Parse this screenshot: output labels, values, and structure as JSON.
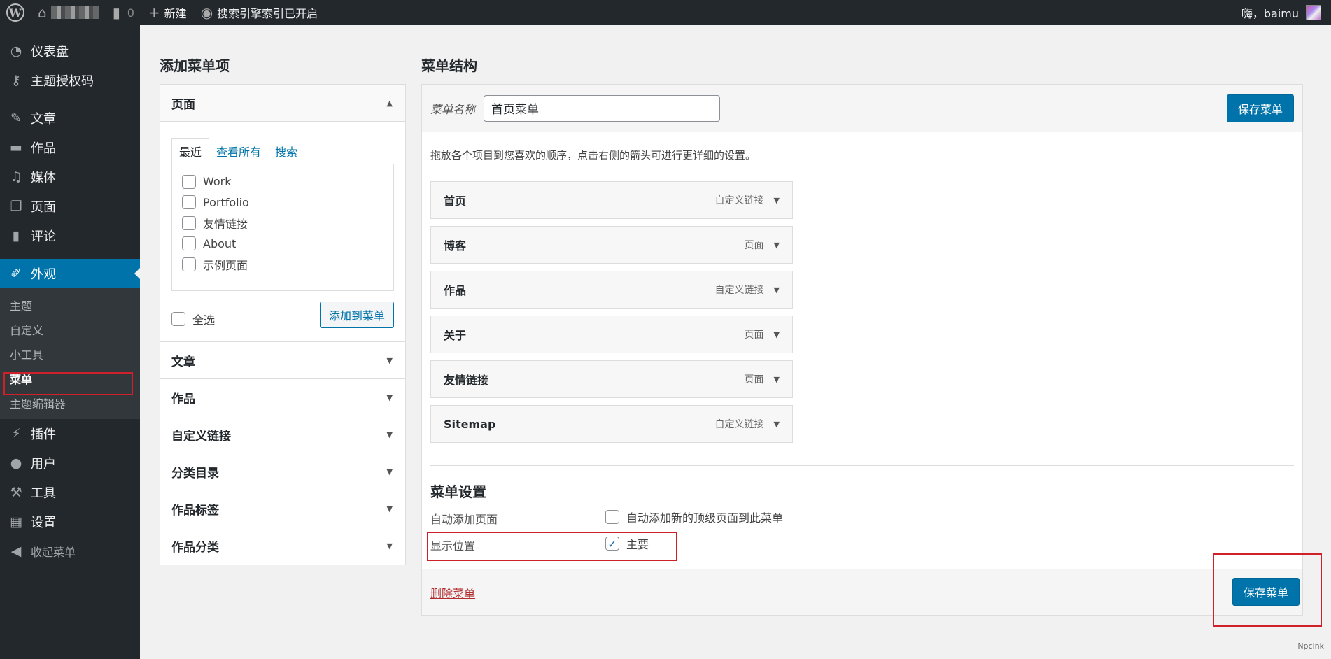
{
  "adminbar": {
    "site_comments": "0",
    "new_label": "新建",
    "search_notice": "搜索引擎索引已开启",
    "greeting": "嗨，baimu"
  },
  "sidebar": {
    "items": [
      {
        "label": "仪表盘",
        "icon": "dashboard-icon"
      },
      {
        "label": "主题授权码",
        "icon": "key-icon"
      },
      {
        "label": "文章",
        "icon": "pin-icon"
      },
      {
        "label": "作品",
        "icon": "folder-icon"
      },
      {
        "label": "媒体",
        "icon": "media-icon"
      },
      {
        "label": "页面",
        "icon": "page-icon"
      },
      {
        "label": "评论",
        "icon": "comment-icon"
      },
      {
        "label": "外观",
        "icon": "brush-icon"
      }
    ],
    "submenu": [
      "主题",
      "自定义",
      "小工具",
      "菜单",
      "主题编辑器"
    ],
    "items_bottom": [
      {
        "label": "插件",
        "icon": "plugin-icon"
      },
      {
        "label": "用户",
        "icon": "user-icon"
      },
      {
        "label": "工具",
        "icon": "wrench-icon"
      },
      {
        "label": "设置",
        "icon": "settings-icon"
      }
    ],
    "collapse_label": "收起菜单"
  },
  "add_items": {
    "title": "添加菜单项",
    "pages_section": "页面",
    "tabs": [
      "最近",
      "查看所有",
      "搜索"
    ],
    "pages": [
      "Work",
      "Portfolio",
      "友情链接",
      "About",
      "示例页面"
    ],
    "select_all": "全选",
    "add_button": "添加到菜单",
    "sections": [
      "文章",
      "作品",
      "自定义链接",
      "分类目录",
      "作品标签",
      "作品分类"
    ]
  },
  "structure": {
    "title": "菜单结构",
    "name_label": "菜单名称",
    "name_value": "首页菜单",
    "save_label": "保存菜单",
    "instructions": "拖放各个项目到您喜欢的顺序，点击右侧的箭头可进行更详细的设置。",
    "menu_items": [
      {
        "title": "首页",
        "type": "自定义链接"
      },
      {
        "title": "博客",
        "type": "页面"
      },
      {
        "title": "作品",
        "type": "自定义链接"
      },
      {
        "title": "关于",
        "type": "页面"
      },
      {
        "title": "友情链接",
        "type": "页面"
      },
      {
        "title": "Sitemap",
        "type": "自定义链接"
      }
    ],
    "settings_title": "菜单设置",
    "auto_add_label": "自动添加页面",
    "auto_add_option": "自动添加新的顶级页面到此菜单",
    "location_label": "显示位置",
    "location_option": "主要",
    "delete_label": "删除菜单"
  },
  "watermark": "Npcink",
  "colors": {
    "accent": "#0073aa",
    "highlight": "#d0202a",
    "sidebar_bg": "#23282d"
  }
}
